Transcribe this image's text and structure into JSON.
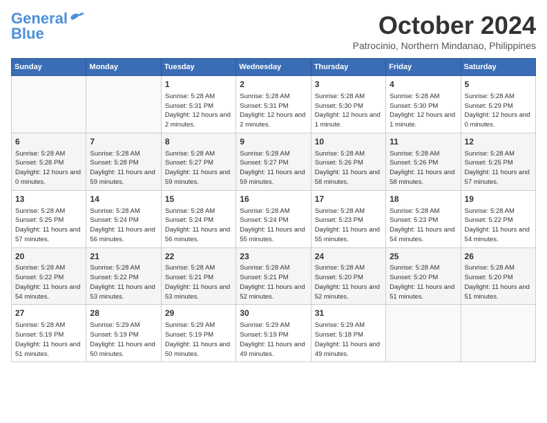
{
  "header": {
    "logo_line1": "General",
    "logo_line2": "Blue",
    "month": "October 2024",
    "location": "Patrocinio, Northern Mindanao, Philippines"
  },
  "weekdays": [
    "Sunday",
    "Monday",
    "Tuesday",
    "Wednesday",
    "Thursday",
    "Friday",
    "Saturday"
  ],
  "weeks": [
    [
      null,
      null,
      {
        "day": "1",
        "sunrise": "Sunrise: 5:28 AM",
        "sunset": "Sunset: 5:31 PM",
        "daylight": "Daylight: 12 hours and 2 minutes."
      },
      {
        "day": "2",
        "sunrise": "Sunrise: 5:28 AM",
        "sunset": "Sunset: 5:31 PM",
        "daylight": "Daylight: 12 hours and 2 minutes."
      },
      {
        "day": "3",
        "sunrise": "Sunrise: 5:28 AM",
        "sunset": "Sunset: 5:30 PM",
        "daylight": "Daylight: 12 hours and 1 minute."
      },
      {
        "day": "4",
        "sunrise": "Sunrise: 5:28 AM",
        "sunset": "Sunset: 5:30 PM",
        "daylight": "Daylight: 12 hours and 1 minute."
      },
      {
        "day": "5",
        "sunrise": "Sunrise: 5:28 AM",
        "sunset": "Sunset: 5:29 PM",
        "daylight": "Daylight: 12 hours and 0 minutes."
      }
    ],
    [
      {
        "day": "6",
        "sunrise": "Sunrise: 5:28 AM",
        "sunset": "Sunset: 5:28 PM",
        "daylight": "Daylight: 12 hours and 0 minutes."
      },
      {
        "day": "7",
        "sunrise": "Sunrise: 5:28 AM",
        "sunset": "Sunset: 5:28 PM",
        "daylight": "Daylight: 11 hours and 59 minutes."
      },
      {
        "day": "8",
        "sunrise": "Sunrise: 5:28 AM",
        "sunset": "Sunset: 5:27 PM",
        "daylight": "Daylight: 11 hours and 59 minutes."
      },
      {
        "day": "9",
        "sunrise": "Sunrise: 5:28 AM",
        "sunset": "Sunset: 5:27 PM",
        "daylight": "Daylight: 11 hours and 59 minutes."
      },
      {
        "day": "10",
        "sunrise": "Sunrise: 5:28 AM",
        "sunset": "Sunset: 5:26 PM",
        "daylight": "Daylight: 11 hours and 58 minutes."
      },
      {
        "day": "11",
        "sunrise": "Sunrise: 5:28 AM",
        "sunset": "Sunset: 5:26 PM",
        "daylight": "Daylight: 11 hours and 58 minutes."
      },
      {
        "day": "12",
        "sunrise": "Sunrise: 5:28 AM",
        "sunset": "Sunset: 5:25 PM",
        "daylight": "Daylight: 11 hours and 57 minutes."
      }
    ],
    [
      {
        "day": "13",
        "sunrise": "Sunrise: 5:28 AM",
        "sunset": "Sunset: 5:25 PM",
        "daylight": "Daylight: 11 hours and 57 minutes."
      },
      {
        "day": "14",
        "sunrise": "Sunrise: 5:28 AM",
        "sunset": "Sunset: 5:24 PM",
        "daylight": "Daylight: 11 hours and 56 minutes."
      },
      {
        "day": "15",
        "sunrise": "Sunrise: 5:28 AM",
        "sunset": "Sunset: 5:24 PM",
        "daylight": "Daylight: 11 hours and 56 minutes."
      },
      {
        "day": "16",
        "sunrise": "Sunrise: 5:28 AM",
        "sunset": "Sunset: 5:24 PM",
        "daylight": "Daylight: 11 hours and 55 minutes."
      },
      {
        "day": "17",
        "sunrise": "Sunrise: 5:28 AM",
        "sunset": "Sunset: 5:23 PM",
        "daylight": "Daylight: 11 hours and 55 minutes."
      },
      {
        "day": "18",
        "sunrise": "Sunrise: 5:28 AM",
        "sunset": "Sunset: 5:23 PM",
        "daylight": "Daylight: 11 hours and 54 minutes."
      },
      {
        "day": "19",
        "sunrise": "Sunrise: 5:28 AM",
        "sunset": "Sunset: 5:22 PM",
        "daylight": "Daylight: 11 hours and 54 minutes."
      }
    ],
    [
      {
        "day": "20",
        "sunrise": "Sunrise: 5:28 AM",
        "sunset": "Sunset: 5:22 PM",
        "daylight": "Daylight: 11 hours and 54 minutes."
      },
      {
        "day": "21",
        "sunrise": "Sunrise: 5:28 AM",
        "sunset": "Sunset: 5:22 PM",
        "daylight": "Daylight: 11 hours and 53 minutes."
      },
      {
        "day": "22",
        "sunrise": "Sunrise: 5:28 AM",
        "sunset": "Sunset: 5:21 PM",
        "daylight": "Daylight: 11 hours and 53 minutes."
      },
      {
        "day": "23",
        "sunrise": "Sunrise: 5:28 AM",
        "sunset": "Sunset: 5:21 PM",
        "daylight": "Daylight: 11 hours and 52 minutes."
      },
      {
        "day": "24",
        "sunrise": "Sunrise: 5:28 AM",
        "sunset": "Sunset: 5:20 PM",
        "daylight": "Daylight: 11 hours and 52 minutes."
      },
      {
        "day": "25",
        "sunrise": "Sunrise: 5:28 AM",
        "sunset": "Sunset: 5:20 PM",
        "daylight": "Daylight: 11 hours and 51 minutes."
      },
      {
        "day": "26",
        "sunrise": "Sunrise: 5:28 AM",
        "sunset": "Sunset: 5:20 PM",
        "daylight": "Daylight: 11 hours and 51 minutes."
      }
    ],
    [
      {
        "day": "27",
        "sunrise": "Sunrise: 5:28 AM",
        "sunset": "Sunset: 5:19 PM",
        "daylight": "Daylight: 11 hours and 51 minutes."
      },
      {
        "day": "28",
        "sunrise": "Sunrise: 5:29 AM",
        "sunset": "Sunset: 5:19 PM",
        "daylight": "Daylight: 11 hours and 50 minutes."
      },
      {
        "day": "29",
        "sunrise": "Sunrise: 5:29 AM",
        "sunset": "Sunset: 5:19 PM",
        "daylight": "Daylight: 11 hours and 50 minutes."
      },
      {
        "day": "30",
        "sunrise": "Sunrise: 5:29 AM",
        "sunset": "Sunset: 5:19 PM",
        "daylight": "Daylight: 11 hours and 49 minutes."
      },
      {
        "day": "31",
        "sunrise": "Sunrise: 5:29 AM",
        "sunset": "Sunset: 5:18 PM",
        "daylight": "Daylight: 11 hours and 49 minutes."
      },
      null,
      null
    ]
  ]
}
